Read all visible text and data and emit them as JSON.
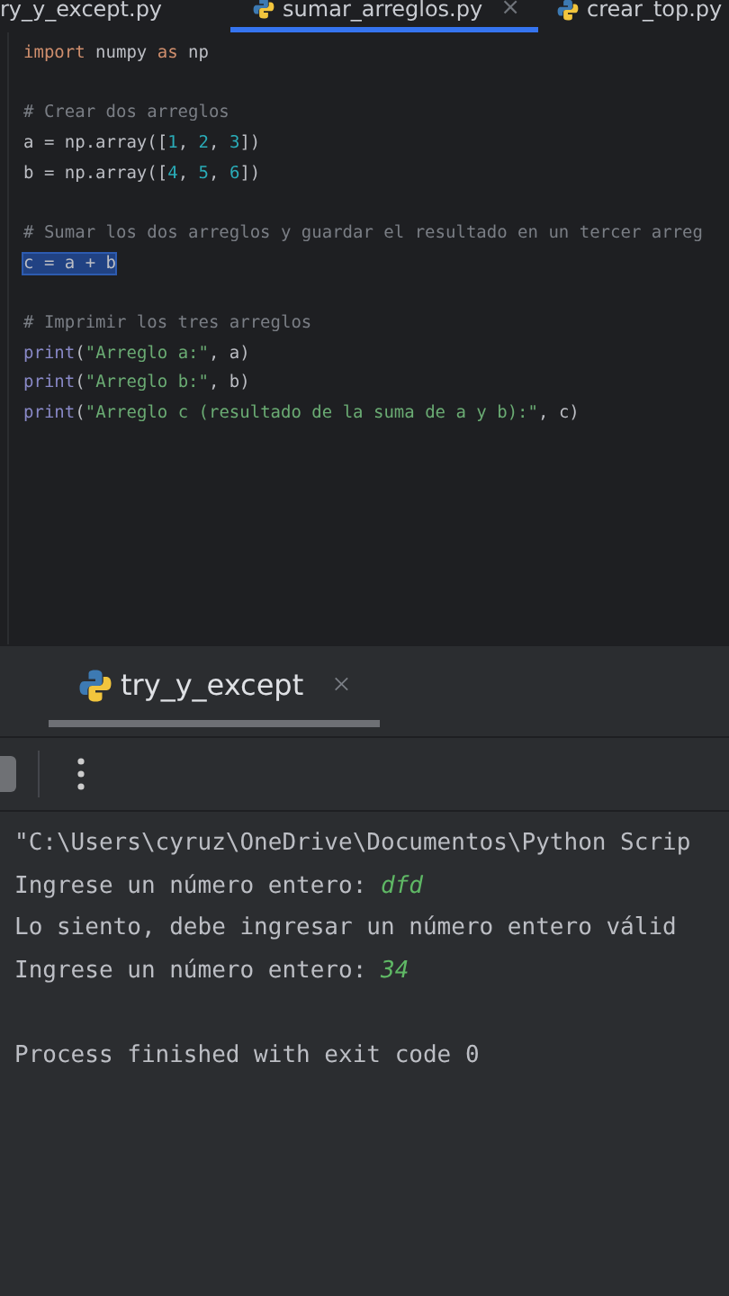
{
  "editor_tabs": [
    {
      "label": "ry_y_except.py",
      "selected": false,
      "icon": false
    },
    {
      "label": "sumar_arreglos.py",
      "selected": true,
      "icon": true,
      "close": "×"
    },
    {
      "label": "crear_top.py",
      "selected": false,
      "icon": true
    }
  ],
  "code_blocks": [
    [
      {
        "selected": false,
        "segments": [
          {
            "kind": "keyword",
            "text": "import"
          },
          {
            "kind": "plain",
            "text": " numpy "
          },
          {
            "kind": "keyword",
            "text": "as"
          },
          {
            "kind": "plain",
            "text": " np"
          }
        ]
      }
    ],
    [
      {
        "selected": false,
        "segments": [
          {
            "kind": "comment",
            "text": "# Crear dos arreglos"
          }
        ]
      },
      {
        "selected": false,
        "segments": [
          {
            "kind": "plain",
            "text": "a = np.array(["
          },
          {
            "kind": "number",
            "text": "1"
          },
          {
            "kind": "plain",
            "text": ", "
          },
          {
            "kind": "number",
            "text": "2"
          },
          {
            "kind": "plain",
            "text": ", "
          },
          {
            "kind": "number",
            "text": "3"
          },
          {
            "kind": "plain",
            "text": "])"
          }
        ]
      },
      {
        "selected": false,
        "segments": [
          {
            "kind": "plain",
            "text": "b = np.array(["
          },
          {
            "kind": "number",
            "text": "4"
          },
          {
            "kind": "plain",
            "text": ", "
          },
          {
            "kind": "number",
            "text": "5"
          },
          {
            "kind": "plain",
            "text": ", "
          },
          {
            "kind": "number",
            "text": "6"
          },
          {
            "kind": "plain",
            "text": "])"
          }
        ]
      }
    ],
    [
      {
        "selected": false,
        "segments": [
          {
            "kind": "comment",
            "text": "# Sumar los dos arreglos y guardar el resultado en un tercer arreg"
          }
        ]
      },
      {
        "selected": true,
        "segments": [
          {
            "kind": "plain",
            "text": "c = a + b"
          }
        ]
      }
    ],
    [
      {
        "selected": false,
        "segments": [
          {
            "kind": "comment",
            "text": "# Imprimir los tres arreglos"
          }
        ]
      },
      {
        "selected": false,
        "segments": [
          {
            "kind": "builtin",
            "text": "print"
          },
          {
            "kind": "plain",
            "text": "("
          },
          {
            "kind": "string",
            "text": "\"Arreglo a:\""
          },
          {
            "kind": "plain",
            "text": ", a)"
          }
        ]
      },
      {
        "selected": false,
        "segments": [
          {
            "kind": "builtin",
            "text": "print"
          },
          {
            "kind": "plain",
            "text": "("
          },
          {
            "kind": "string",
            "text": "\"Arreglo b:\""
          },
          {
            "kind": "plain",
            "text": ", b)"
          }
        ]
      },
      {
        "selected": false,
        "segments": [
          {
            "kind": "builtin",
            "text": "print"
          },
          {
            "kind": "plain",
            "text": "("
          },
          {
            "kind": "string",
            "text": "\"Arreglo c (resultado de la suma de a y b):\""
          },
          {
            "kind": "plain",
            "text": ", c)"
          }
        ]
      }
    ]
  ],
  "run_tab": {
    "label": "try_y_except",
    "selected": true,
    "close": "×"
  },
  "console_blocks": [
    [
      {
        "segments": [
          {
            "kind": "output",
            "text": "\"C:\\Users\\cyruz\\OneDrive\\Documentos\\Python Scrip"
          }
        ]
      },
      {
        "segments": [
          {
            "kind": "output",
            "text": "Ingrese un número entero: "
          },
          {
            "kind": "input",
            "text": "dfd"
          }
        ]
      },
      {
        "segments": [
          {
            "kind": "output",
            "text": "Lo siento, debe ingresar un número entero válid"
          }
        ]
      },
      {
        "segments": [
          {
            "kind": "output",
            "text": "Ingrese un número entero: "
          },
          {
            "kind": "input",
            "text": "34"
          }
        ]
      }
    ],
    [
      {
        "segments": [
          {
            "kind": "output",
            "text": "Process finished with exit code 0"
          }
        ]
      }
    ]
  ]
}
